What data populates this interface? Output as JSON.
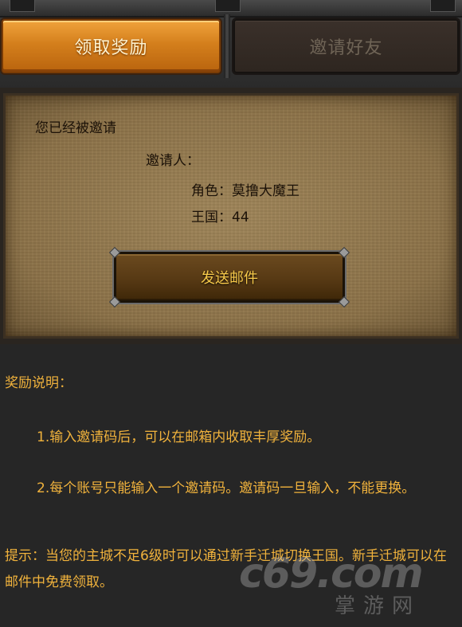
{
  "tabs": {
    "claim_reward": "领取奖励",
    "invite_friends": "邀请好友"
  },
  "invite_card": {
    "title": "您已经被邀请",
    "inviter_label": "邀请人：",
    "role_line": "角色：莫撸大魔王",
    "kingdom_line": "王国：44",
    "send_mail_button": "发送邮件"
  },
  "reward_info": {
    "title": "奖励说明：",
    "item1": "1.输入邀请码后，可以在邮箱内收取丰厚奖励。",
    "item2": "2.每个账号只能输入一个邀请码。邀请码一旦输入，不能更换。",
    "tip": "提示：当您的主城不足6级时可以通过新手迁城切换王国。新手迁城可以在邮件中免费领取。"
  },
  "watermark": {
    "logo": "c69.com",
    "sub": "掌游网"
  }
}
